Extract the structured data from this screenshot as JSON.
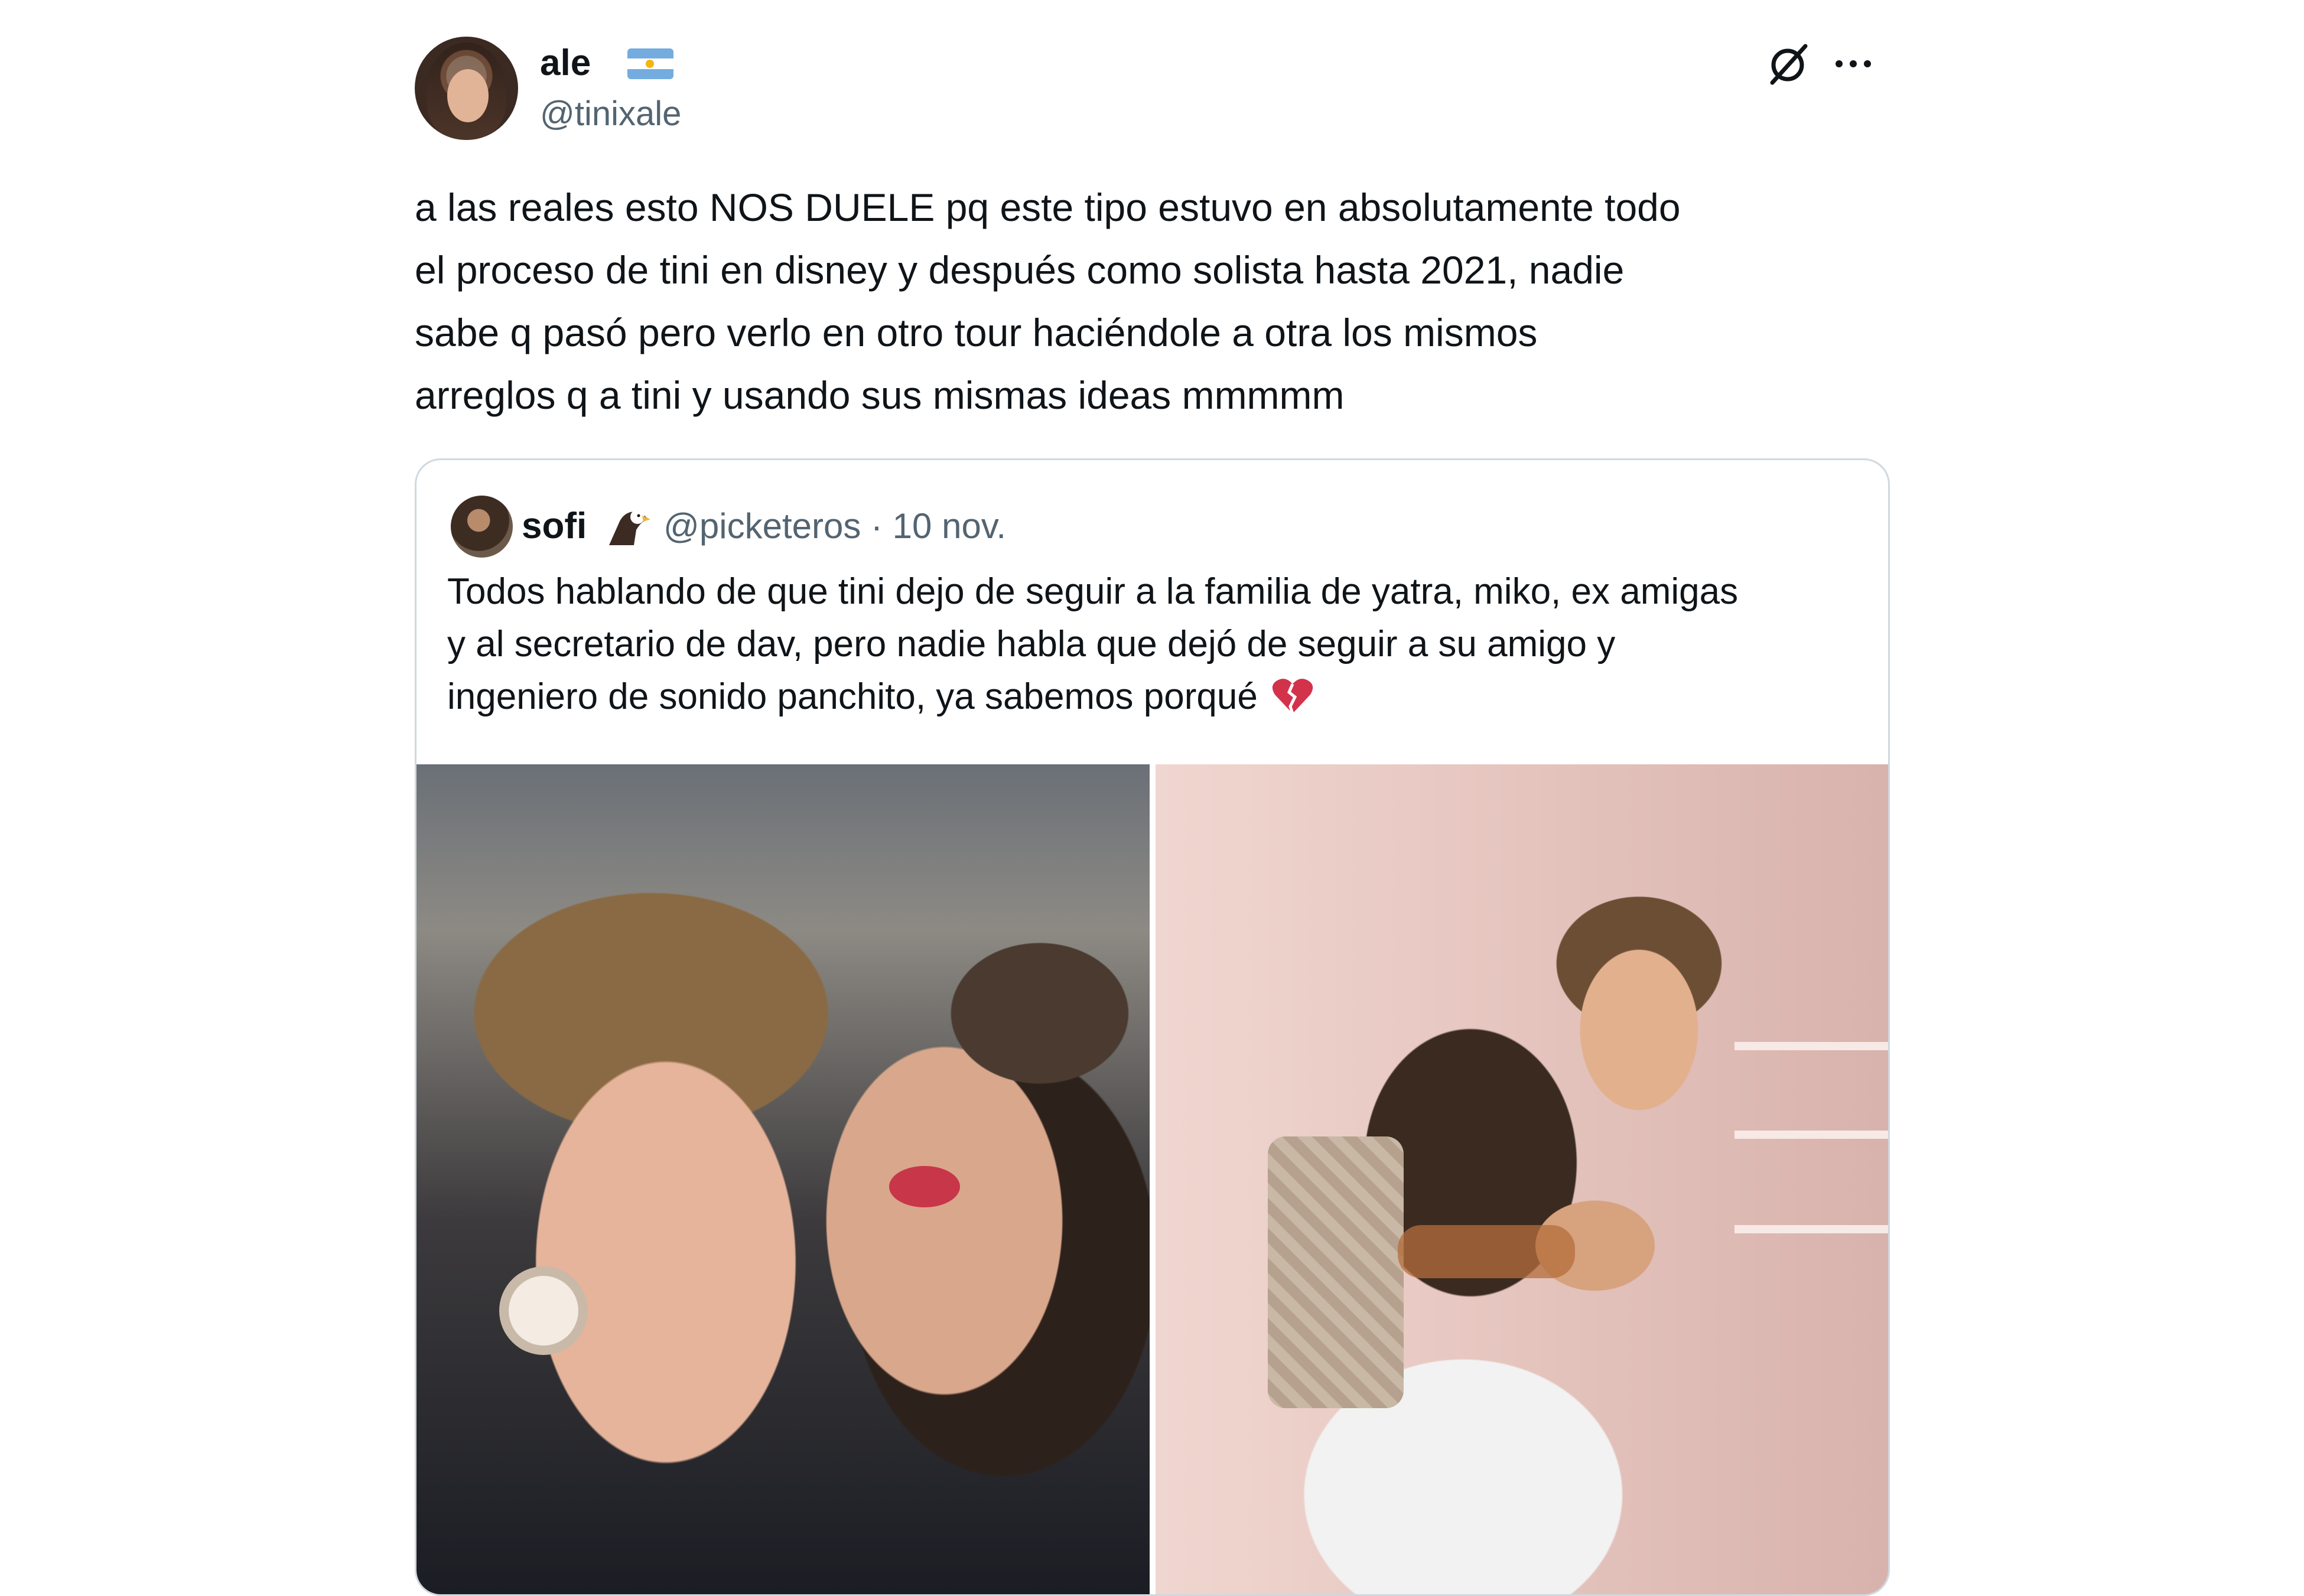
{
  "tweet": {
    "display_name": "ale",
    "handle": "@tinixale",
    "text": "a las reales esto NOS DUELE pq este tipo estuvo en absolutamente todo\nel proceso de tini en disney y después como solista hasta 2021, nadie\nsabe q pasó pero verlo en otro tour haciéndole a otra los mismos\narreglos q a tini y usando sus mismas ideas mmmmm"
  },
  "quoted": {
    "display_name": "sofi",
    "handle_date": "@picketeros · 10 nov.",
    "text": "Todos hablando de que tini dejo de seguir a la familia de yatra, miko, ex amigas\ny al secretario de dav, pero nadie habla que dejó de seguir a su amigo y\ningeniero de sonido panchito, ya sabemos porqué"
  },
  "icons": {
    "flag": "argentina-flag-icon",
    "grok": "grok-icon",
    "more": "more-options-icon",
    "eagle": "eagle-emoji-icon",
    "heart": "broken-heart-emoji-icon"
  },
  "colors": {
    "text": "#0f1419",
    "secondary": "#536471",
    "border": "#cfd9de"
  }
}
